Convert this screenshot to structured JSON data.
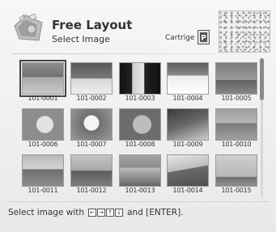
{
  "header": {
    "title": "Free Layout",
    "subtitle": "Select Image",
    "cartridge_label": "Cartrige",
    "cartridge_letter": "P",
    "app_icon": "free-layout-icon"
  },
  "images": [
    {
      "label": "101-0001",
      "selected": true
    },
    {
      "label": "101-0002"
    },
    {
      "label": "101-0003"
    },
    {
      "label": "101-0004"
    },
    {
      "label": "101-0005"
    },
    {
      "label": "101-0006"
    },
    {
      "label": "101-0007"
    },
    {
      "label": "101-0008"
    },
    {
      "label": "101-0009"
    },
    {
      "label": "101-0010"
    },
    {
      "label": "101-0011"
    },
    {
      "label": "101-0012"
    },
    {
      "label": "101-0013"
    },
    {
      "label": "101-0014"
    },
    {
      "label": "101-0015"
    }
  ],
  "footer": {
    "text_before": "Select image with",
    "keys": [
      "←",
      "→",
      "↑",
      "↓"
    ],
    "text_after": "and [ENTER]."
  },
  "colors": {
    "background": "#efefef",
    "selection": "#444444"
  }
}
